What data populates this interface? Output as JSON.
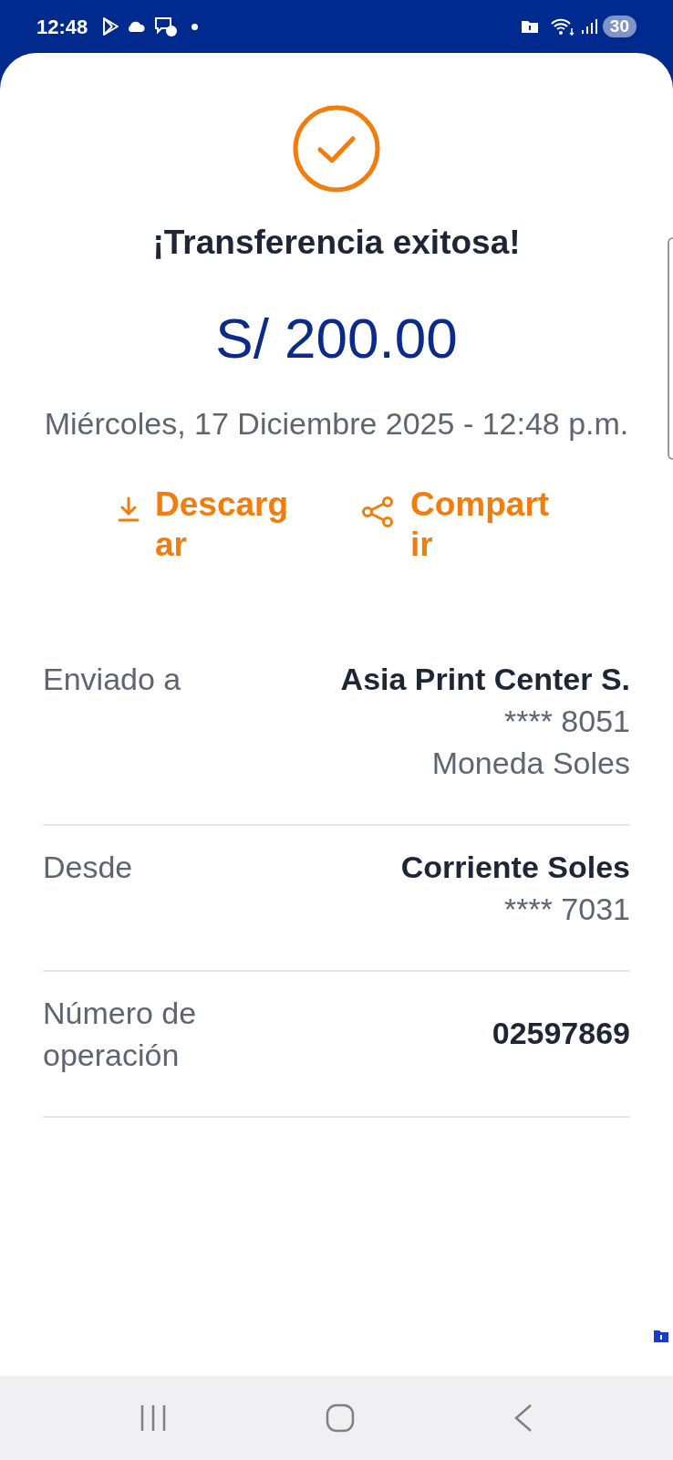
{
  "status_bar": {
    "time": "12:48",
    "battery": "30"
  },
  "result": {
    "title": "¡Transferencia exitosa!",
    "amount": "S/ 200.00",
    "date": "Miércoles, 17 Diciembre 2025 - 12:48 p.m."
  },
  "actions": [
    {
      "kind": "download",
      "label": "Descargar"
    },
    {
      "kind": "share",
      "label": "Compartir"
    }
  ],
  "details": [
    {
      "label": "Enviado a",
      "lines": [
        "Asia Print Center S.",
        "**** 8051",
        "Moneda Soles"
      ]
    },
    {
      "label": "Desde",
      "lines": [
        "Corriente Soles",
        "**** 7031"
      ]
    },
    {
      "label": "Número de operación",
      "lines": [
        "02597869"
      ]
    }
  ]
}
